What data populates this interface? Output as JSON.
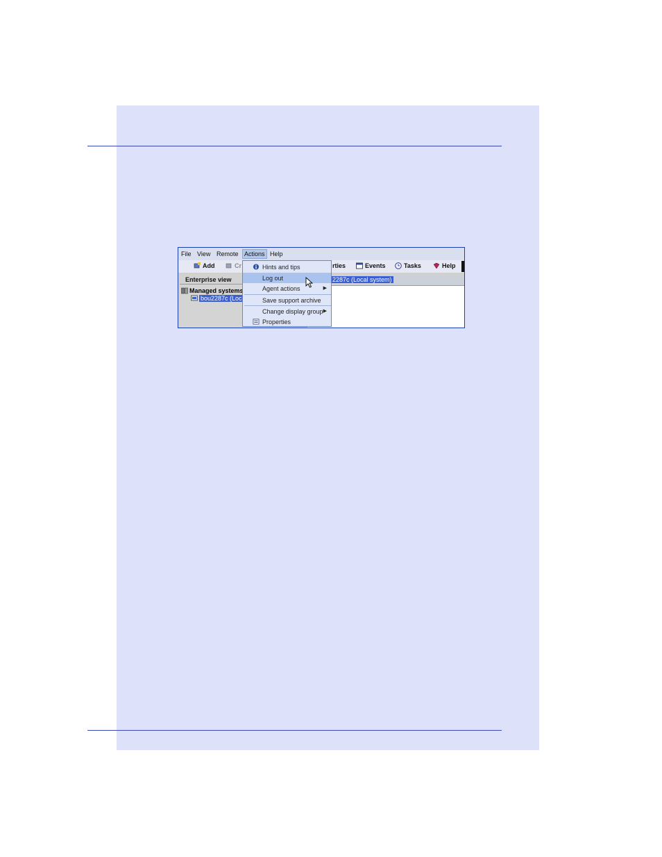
{
  "menubar": {
    "items": [
      "File",
      "View",
      "Remote",
      "Actions",
      "Help"
    ]
  },
  "toolbar": {
    "add": "Add",
    "hidden_partial": "Cr",
    "properties_partial": "rties",
    "events": "Events",
    "tasks": "Tasks",
    "help": "Help"
  },
  "left_pane": {
    "header": "Enterprise view",
    "root": "Managed systems",
    "child": "bou2287c (Loca"
  },
  "right_pane": {
    "header": "2287c (Local system)"
  },
  "actions_menu": {
    "items": [
      {
        "label": "Hints and tips",
        "icon": "info-icon"
      },
      {
        "label": "Log out",
        "highlighted": true
      },
      {
        "label": "Agent actions",
        "submenu": true
      },
      {
        "label": "Save support archive"
      },
      {
        "label": "Change display group",
        "submenu": true
      },
      {
        "label": "Properties",
        "icon": "properties-icon"
      }
    ]
  },
  "colors": {
    "page_panel": "#dde2fa",
    "rule": "#3a4bb8",
    "selection": "#3b5fd0",
    "menu_highlight": "#a9c2ee"
  }
}
